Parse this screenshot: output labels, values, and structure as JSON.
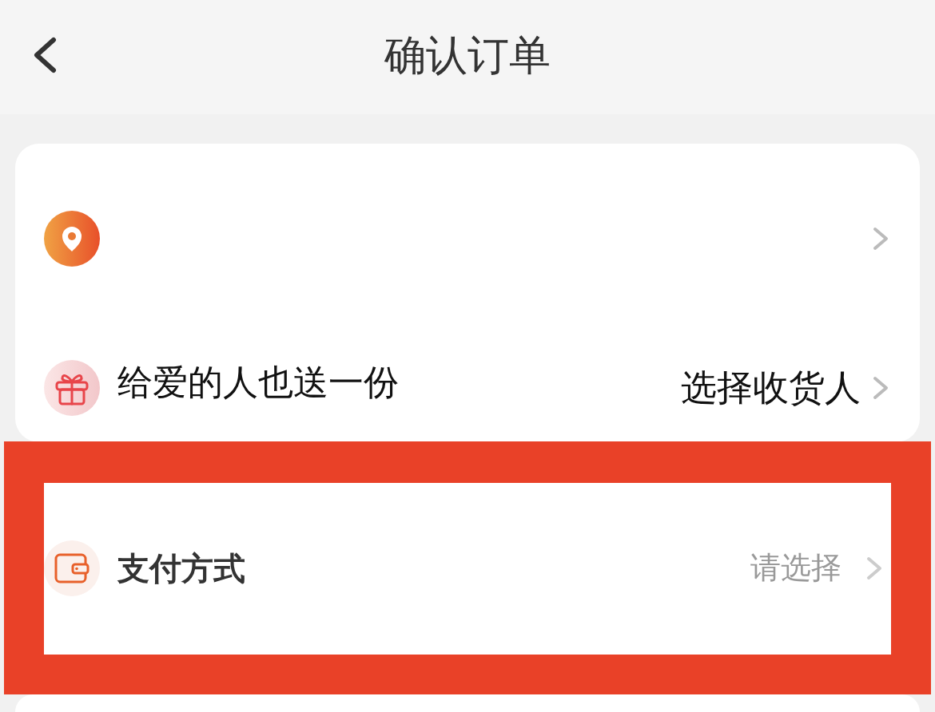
{
  "header": {
    "title": "确认订单"
  },
  "sections": [
    {
      "highlighted": false,
      "rows": [
        {
          "kind": "address"
        },
        {
          "kind": "gift",
          "label": "给爱的人也送一份",
          "action": "选择收货人"
        }
      ]
    },
    {
      "highlighted": true,
      "rows": [
        {
          "kind": "payment",
          "label": "支付方式",
          "placeholder": "请选择"
        }
      ]
    }
  ]
}
